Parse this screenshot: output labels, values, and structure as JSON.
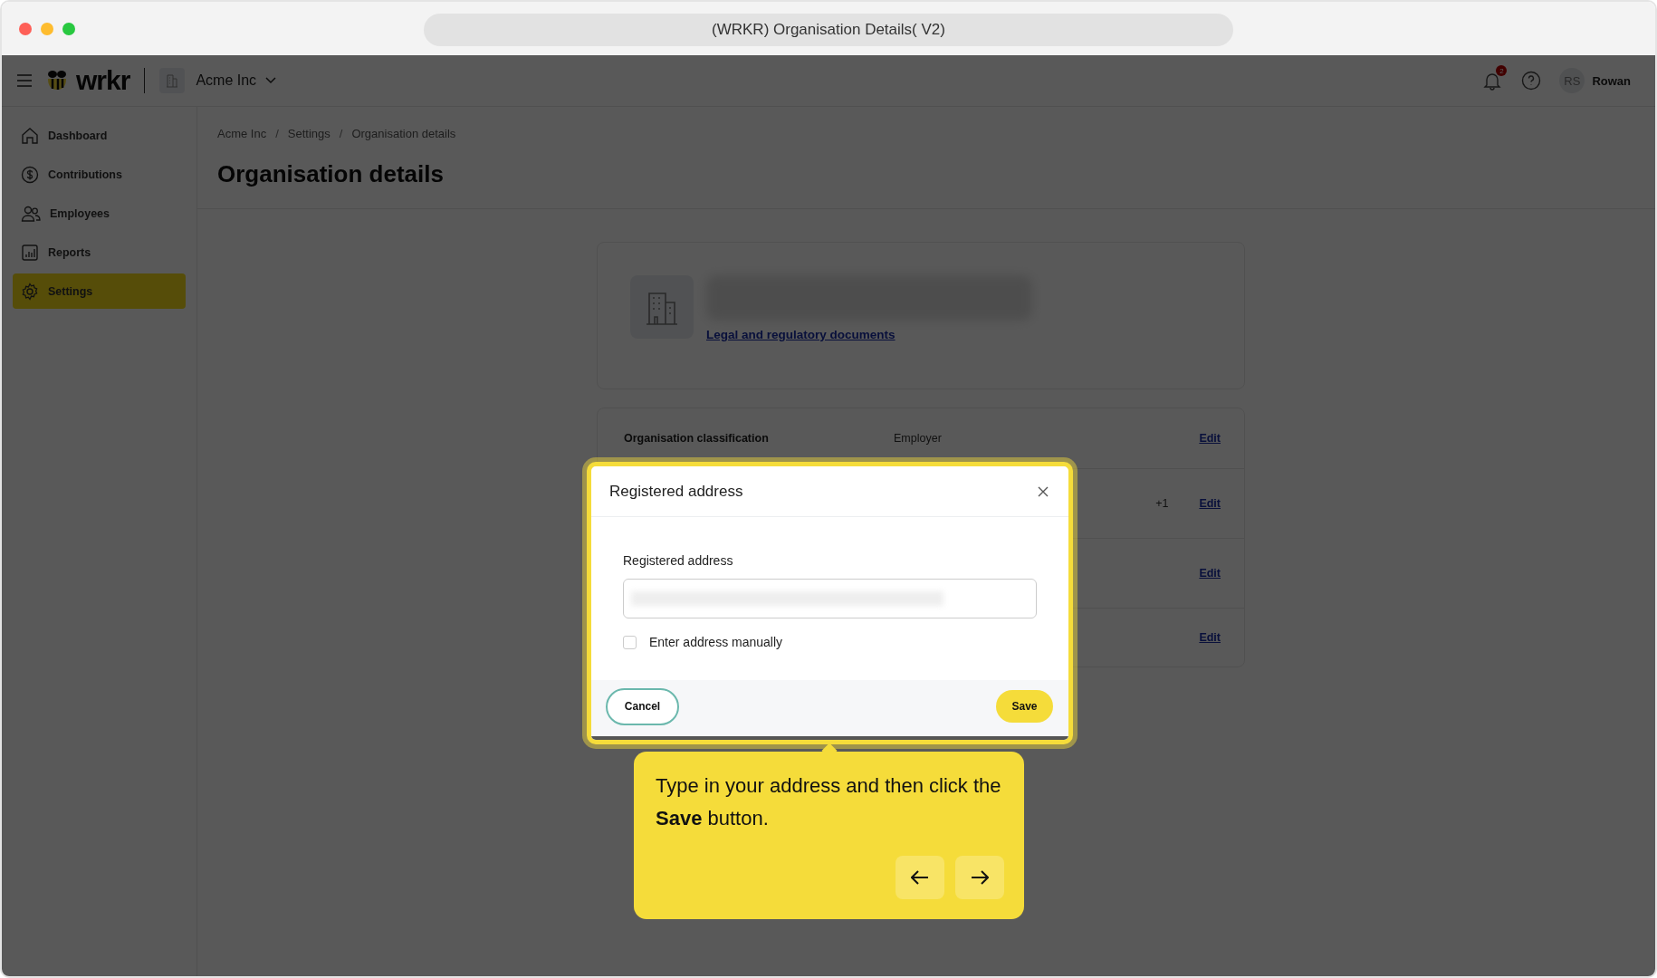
{
  "browser": {
    "title": "(WRKR) Organisation Details( V2)"
  },
  "topbar": {
    "logo": "wrkr",
    "organisation": "Acme Inc",
    "notification_count": "2",
    "avatar_initials": "RS",
    "user_name": "Rowan"
  },
  "sidebar": {
    "items": [
      {
        "label": "Dashboard",
        "kind": "home",
        "selected": false
      },
      {
        "label": "Contributions",
        "kind": "money",
        "selected": false
      },
      {
        "label": "Employees",
        "kind": "people",
        "selected": false
      },
      {
        "label": "Reports",
        "kind": "reports",
        "selected": false
      },
      {
        "label": "Settings",
        "kind": "settings",
        "selected": true
      }
    ]
  },
  "breadcrumb": [
    {
      "kind": "link",
      "text": "Acme Inc"
    },
    {
      "kind": "separator",
      "text": "/"
    },
    {
      "kind": "link",
      "text": "Settings"
    },
    {
      "kind": "separator",
      "text": "/"
    },
    {
      "kind": "link",
      "text": "Organisation details"
    }
  ],
  "page_title": "Organisation details",
  "profile_card": {
    "link": "Legal and regulatory documents"
  },
  "details": [
    {
      "label": "Organisation classification",
      "value": "Employer",
      "action": "Edit"
    },
    {
      "extra": "+1",
      "action": "Edit"
    },
    {
      "action": "Edit"
    },
    {
      "action": "Edit"
    }
  ],
  "modal": {
    "title": "Registered address",
    "field_label": "Registered address",
    "checkbox": {
      "label": "Enter address manually",
      "checked": false
    },
    "cancel": "Cancel",
    "save": "Save"
  },
  "tour_tip": {
    "text": "Type in your address and then click the **Save** button."
  }
}
